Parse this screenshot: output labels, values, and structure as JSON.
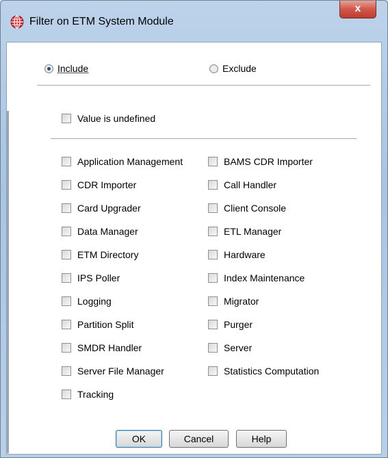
{
  "window": {
    "title": "Filter on ETM System Module",
    "close_symbol": "x",
    "app_icon": "globe-icon"
  },
  "mode": {
    "include_label": "Include",
    "exclude_label": "Exclude",
    "selected": "Include"
  },
  "undefined_option": {
    "label": "Value is undefined",
    "checked": false
  },
  "modules": {
    "left": [
      "Application Management",
      "CDR Importer",
      "Card Upgrader",
      "Data Manager",
      "ETM Directory",
      "IPS Poller",
      "Logging",
      "Partition Split",
      "SMDR Handler",
      "Server File Manager",
      "Tracking"
    ],
    "right": [
      "BAMS CDR Importer",
      "Call Handler",
      "Client Console",
      "ETL Manager",
      "Hardware",
      "Index Maintenance",
      "Migrator",
      "Purger",
      "Server",
      "Statistics Computation"
    ]
  },
  "buttons": {
    "ok": "OK",
    "cancel": "Cancel",
    "help": "Help"
  },
  "colors": {
    "close_button": "#c9463a",
    "selection_dot": "#1d4f8e",
    "default_button_border": "#3c7fb1"
  }
}
